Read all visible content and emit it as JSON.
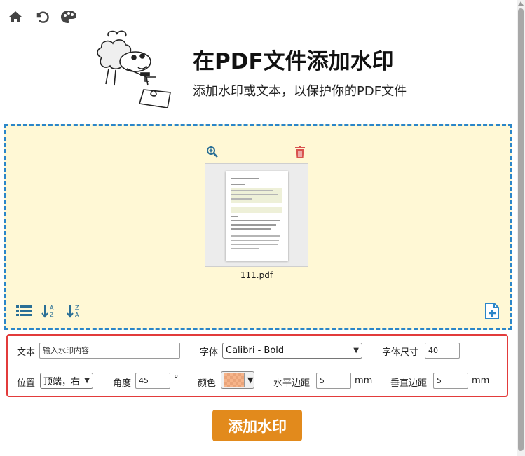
{
  "nav": {
    "home_icon": "home-icon",
    "undo_icon": "undo-icon",
    "palette_icon": "palette-icon"
  },
  "header": {
    "title": "在PDF文件添加水印",
    "subtitle": "添加水印或文本，以保护你的PDF文件"
  },
  "file": {
    "name": "111.pdf"
  },
  "colors": {
    "accent": "#e28a1c",
    "dropzone_bg": "#fff8d5",
    "dropzone_border": "#2b86c9",
    "options_border": "#e23b3b"
  },
  "options": {
    "text_label": "文本",
    "text_placeholder": "输入水印内容",
    "font_label": "字体",
    "font_value": "Calibri - Bold",
    "size_label": "字体尺寸",
    "size_value": "40",
    "position_label": "位置",
    "position_value": "顶端，右",
    "angle_label": "角度",
    "angle_value": "45",
    "angle_unit": "°",
    "color_label": "颜色",
    "hmargin_label": "水平边距",
    "hmargin_value": "5",
    "hmargin_unit": "mm",
    "vmargin_label": "垂直边距",
    "vmargin_value": "5",
    "vmargin_unit": "mm"
  },
  "submit_label": "添加水印"
}
